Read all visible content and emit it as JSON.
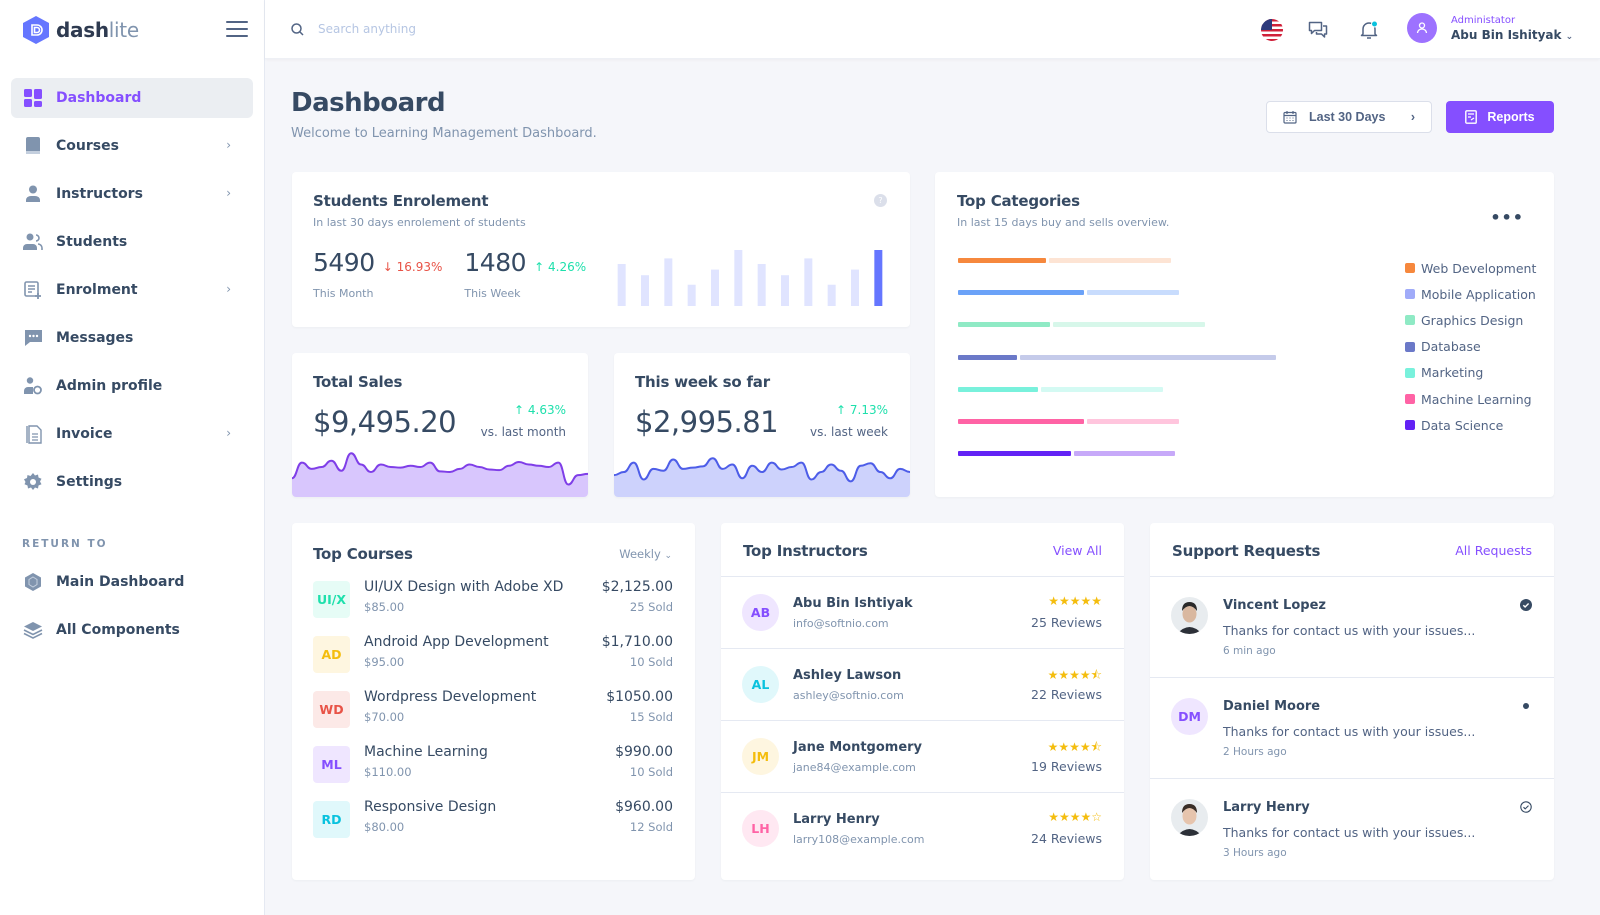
{
  "brand": {
    "name_bold": "dash",
    "name_light": "lite"
  },
  "sidebar": {
    "items": [
      {
        "label": "Dashboard",
        "icon": "dashboard-icon",
        "active": true,
        "has_submenu": false
      },
      {
        "label": "Courses",
        "icon": "book-icon",
        "active": false,
        "has_submenu": true
      },
      {
        "label": "Instructors",
        "icon": "user-icon",
        "active": false,
        "has_submenu": true
      },
      {
        "label": "Students",
        "icon": "users-icon",
        "active": false,
        "has_submenu": false
      },
      {
        "label": "Enrolment",
        "icon": "list-add-icon",
        "active": false,
        "has_submenu": true
      },
      {
        "label": "Messages",
        "icon": "chat-icon",
        "active": false,
        "has_submenu": false
      },
      {
        "label": "Admin profile",
        "icon": "user-settings-icon",
        "active": false,
        "has_submenu": false
      },
      {
        "label": "Invoice",
        "icon": "invoice-icon",
        "active": false,
        "has_submenu": true
      },
      {
        "label": "Settings",
        "icon": "gear-icon",
        "active": false,
        "has_submenu": false
      }
    ],
    "section_label": "RETURN TO",
    "return_items": [
      {
        "label": "Main Dashboard",
        "icon": "hexagon-icon"
      },
      {
        "label": "All Components",
        "icon": "layers-icon"
      }
    ]
  },
  "header": {
    "search_placeholder": "Search anything",
    "user_role": "Administator",
    "user_name": "Abu Bin Ishityak"
  },
  "page": {
    "title": "Dashboard",
    "subtitle": "Welcome to Learning Management Dashboard.",
    "date_range_label": "Last 30 Days",
    "reports_label": "Reports"
  },
  "enrolment": {
    "title": "Students Enrolement",
    "subtitle": "In last 30 days enrolement of students",
    "month_value": "5490",
    "month_change": "↓ 16.93%",
    "month_label": "This Month",
    "week_value": "1480",
    "week_change": "↑ 4.26%",
    "week_label": "This Week"
  },
  "total_sales": {
    "title": "Total Sales",
    "amount": "$9,495.20",
    "change": "↑ 4.63%",
    "compare": "vs. last month"
  },
  "week_sales": {
    "title": "This week so far",
    "amount": "$2,995.81",
    "change": "↑ 7.13%",
    "compare": "vs. last week"
  },
  "top_categories": {
    "title": "Top Categories",
    "subtitle": "In last 15 days buy and sells overview."
  },
  "top_courses": {
    "title": "Top Courses",
    "filter": "Weekly",
    "items": [
      {
        "initials": "UI/X",
        "name": "UI/UX Design with Adobe XD",
        "price": "$85.00",
        "total": "$2,125.00",
        "sold": "25 Sold",
        "fg": "#1ee0ac",
        "bg": "#e6fcf6"
      },
      {
        "initials": "AD",
        "name": "Android App Development",
        "price": "$95.00",
        "total": "$1,710.00",
        "sold": "10 Sold",
        "fg": "#f4bd0e",
        "bg": "#fef6e0"
      },
      {
        "initials": "WD",
        "name": "Wordpress Development",
        "price": "$70.00",
        "total": "$1050.00",
        "sold": "15 Sold",
        "fg": "#e85347",
        "bg": "#fce9e7"
      },
      {
        "initials": "ML",
        "name": "Machine Learning",
        "price": "$110.00",
        "total": "$990.00",
        "sold": "10 Sold",
        "fg": "#854fff",
        "bg": "#efe6ff"
      },
      {
        "initials": "RD",
        "name": "Responsive Design",
        "price": "$80.00",
        "total": "$960.00",
        "sold": "12 Sold",
        "fg": "#09c2de",
        "bg": "#e0f8fb"
      }
    ]
  },
  "top_instructors": {
    "title": "Top Instructors",
    "link": "View All",
    "items": [
      {
        "initials": "AB",
        "name": "Abu Bin Ishtiyak",
        "email": "info@softnio.com",
        "rating": 5,
        "stars": "★★★★★",
        "reviews": "25 Reviews",
        "fg": "#854fff",
        "bg": "#efe6ff"
      },
      {
        "initials": "AL",
        "name": "Ashley Lawson",
        "email": "ashley@softnio.com",
        "rating": 4.5,
        "stars": "★★★★⯪",
        "reviews": "22 Reviews",
        "fg": "#09c2de",
        "bg": "#e0f8fb"
      },
      {
        "initials": "JM",
        "name": "Jane Montgomery",
        "email": "jane84@example.com",
        "rating": 4.5,
        "stars": "★★★★⯪",
        "reviews": "19 Reviews",
        "fg": "#f4bd0e",
        "bg": "#fef6e0"
      },
      {
        "initials": "LH",
        "name": "Larry Henry",
        "email": "larry108@example.com",
        "rating": 4,
        "stars": "★★★★☆",
        "reviews": "24 Reviews",
        "fg": "#ff63a5",
        "bg": "#ffe8f2"
      }
    ]
  },
  "support": {
    "title": "Support Requests",
    "link": "All Requests",
    "items": [
      {
        "initials": "",
        "photo": true,
        "name": "Vincent Lopez",
        "message": "Thanks for contact us with your issues...",
        "time": "6 min ago",
        "status": "resolved"
      },
      {
        "initials": "DM",
        "photo": false,
        "name": "Daniel Moore",
        "message": "Thanks for contact us with your issues...",
        "time": "2 Hours ago",
        "status": "new"
      },
      {
        "initials": "",
        "photo": true,
        "name": "Larry Henry",
        "message": "Thanks for contact us with your issues...",
        "time": "3 Hours ago",
        "status": "read"
      }
    ]
  },
  "colors": {
    "accent": "#854fff",
    "positive": "#1ee0ac",
    "negative": "#e85347",
    "text": "#364a63",
    "muted": "#8094ae"
  },
  "chart_data": [
    {
      "id": "enrolment-bars",
      "type": "bar",
      "title": "Students Enrolement",
      "categories": [
        "1",
        "2",
        "3",
        "4",
        "5",
        "6",
        "7",
        "8",
        "9",
        "10",
        "11",
        "12"
      ],
      "values": [
        75,
        55,
        85,
        38,
        65,
        100,
        75,
        55,
        85,
        38,
        65,
        100
      ],
      "highlight_index": 11,
      "colors": {
        "bar": "#e0e4ff",
        "highlight": "#6576ff"
      },
      "ylim": [
        0,
        100
      ],
      "grid": false
    },
    {
      "id": "total-sales-spark",
      "type": "area",
      "title": "Total Sales",
      "values": [
        30,
        55,
        45,
        48,
        58,
        42,
        70,
        52,
        40,
        52,
        48,
        47,
        50,
        48,
        55,
        41,
        40,
        45,
        52,
        48,
        44,
        43,
        50,
        56,
        52,
        50,
        48,
        55,
        20,
        35,
        37
      ],
      "ylim": [
        0,
        80
      ],
      "colors": {
        "line": "#7f3ee8",
        "fill": "#d8c6fd"
      }
    },
    {
      "id": "week-sales-spark",
      "type": "area",
      "title": "This week so far",
      "values": [
        35,
        40,
        55,
        28,
        45,
        42,
        60,
        45,
        47,
        49,
        62,
        45,
        52,
        30,
        50,
        40,
        55,
        44,
        48,
        55,
        28,
        40,
        52,
        42,
        25,
        50,
        54,
        40,
        30,
        45,
        40
      ],
      "ylim": [
        0,
        80
      ],
      "colors": {
        "line": "#4d5de8",
        "fill": "#cdd2fc"
      }
    },
    {
      "id": "top-categories",
      "type": "bar",
      "orientation": "horizontal",
      "stacked": true,
      "title": "Top Categories",
      "categories": [
        "Web Development",
        "Mobile Application",
        "Graphics Design",
        "Database",
        "Marketing",
        "Machine Learning",
        "Data Science"
      ],
      "series": [
        {
          "name": "current",
          "values": [
            21,
            30,
            22,
            14,
            19,
            30,
            27
          ]
        },
        {
          "name": "previous",
          "values": [
            29,
            22,
            36,
            61,
            29,
            22,
            24
          ]
        }
      ],
      "colors": [
        {
          "solid": "#f6883d",
          "light": "#fde4d4"
        },
        {
          "solid": "#6ba2f8",
          "light": "#c8dcfd"
        },
        {
          "solid": "#8feac5",
          "light": "#d7f7ea"
        },
        {
          "solid": "#6b79c8",
          "light": "#c5cbea"
        },
        {
          "solid": "#79f1dc",
          "light": "#d4faf3"
        },
        {
          "solid": "#ff63a5",
          "light": "#ffc5dd"
        },
        {
          "solid": "#6322f5",
          "light": "#c7a9f9"
        }
      ],
      "legend_colors": [
        "#f6883d",
        "#a0abf9",
        "#8feac5",
        "#6b79c8",
        "#79f1dc",
        "#ff63a5",
        "#6322f5"
      ],
      "xlim": [
        0,
        100
      ],
      "legend": "right",
      "grid": false
    }
  ]
}
